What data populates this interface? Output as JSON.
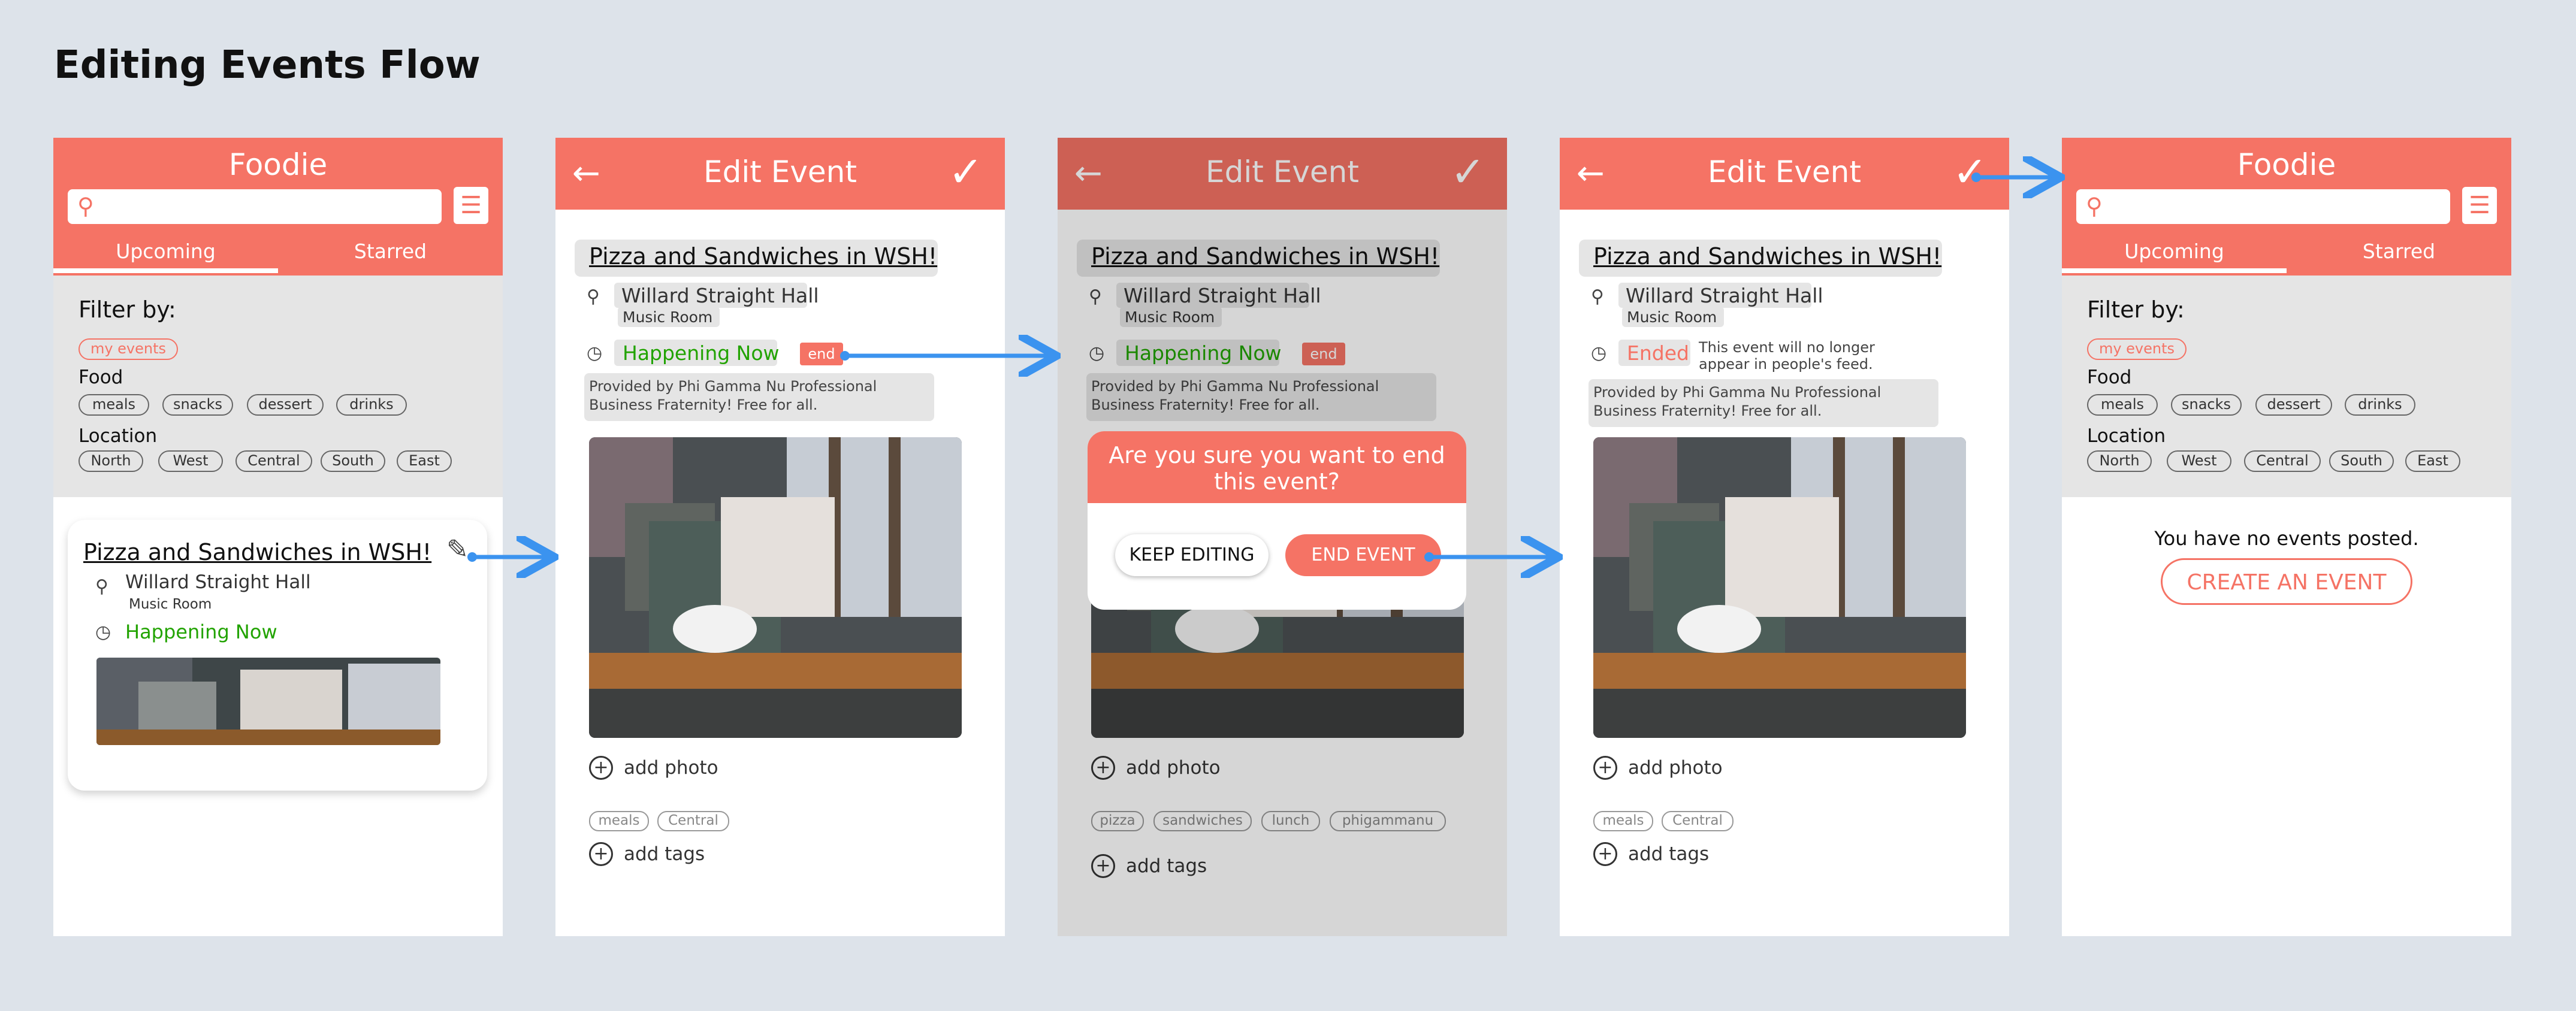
{
  "page": {
    "title": "Editing Events Flow"
  },
  "colors": {
    "accent": "#f57365",
    "status_green": "#21a300",
    "flow_arrow": "#3b93ef",
    "canvas": "#dde3ea"
  },
  "foodie": {
    "title": "Foodie",
    "search": {
      "placeholder": "",
      "icon": "search-icon"
    },
    "filter_icon": "sliders-icon",
    "tabs": [
      "Upcoming",
      "Starred"
    ],
    "filter_by": "Filter by:",
    "my_events_chip": "my events",
    "food_label": "Food",
    "food_chips": [
      "meals",
      "snacks",
      "dessert",
      "drinks"
    ],
    "location_label": "Location",
    "location_chips": [
      "North",
      "West",
      "Central",
      "South",
      "East"
    ]
  },
  "card": {
    "title": "Pizza and Sandwiches in WSH!",
    "place": "Willard Straight Hall",
    "room": "Music Room",
    "status": "Happening Now"
  },
  "edit": {
    "title": "Edit Event",
    "event_title": "Pizza and Sandwiches in WSH!",
    "place": "Willard Straight Hall",
    "room": "Music Room",
    "status": "Happening Now",
    "end_button": "end",
    "description": "Provided by Phi Gamma Nu Professional Business Fraternity! Free for all.",
    "add_photo": "add photo",
    "add_tags": "add tags",
    "tags": [
      "meals",
      "Central"
    ]
  },
  "dialog": {
    "tags": [
      "pizza",
      "sandwiches",
      "lunch",
      "phigammanu"
    ],
    "question": "Are you sure you want to end this event?",
    "keep_editing": "KEEP EDITING",
    "end_event": "END EVENT"
  },
  "ended": {
    "status": "Ended",
    "note": "This event will no longer appear in people's feed."
  },
  "empty": {
    "message": "You have no events posted.",
    "create_button": "CREATE AN EVENT"
  }
}
